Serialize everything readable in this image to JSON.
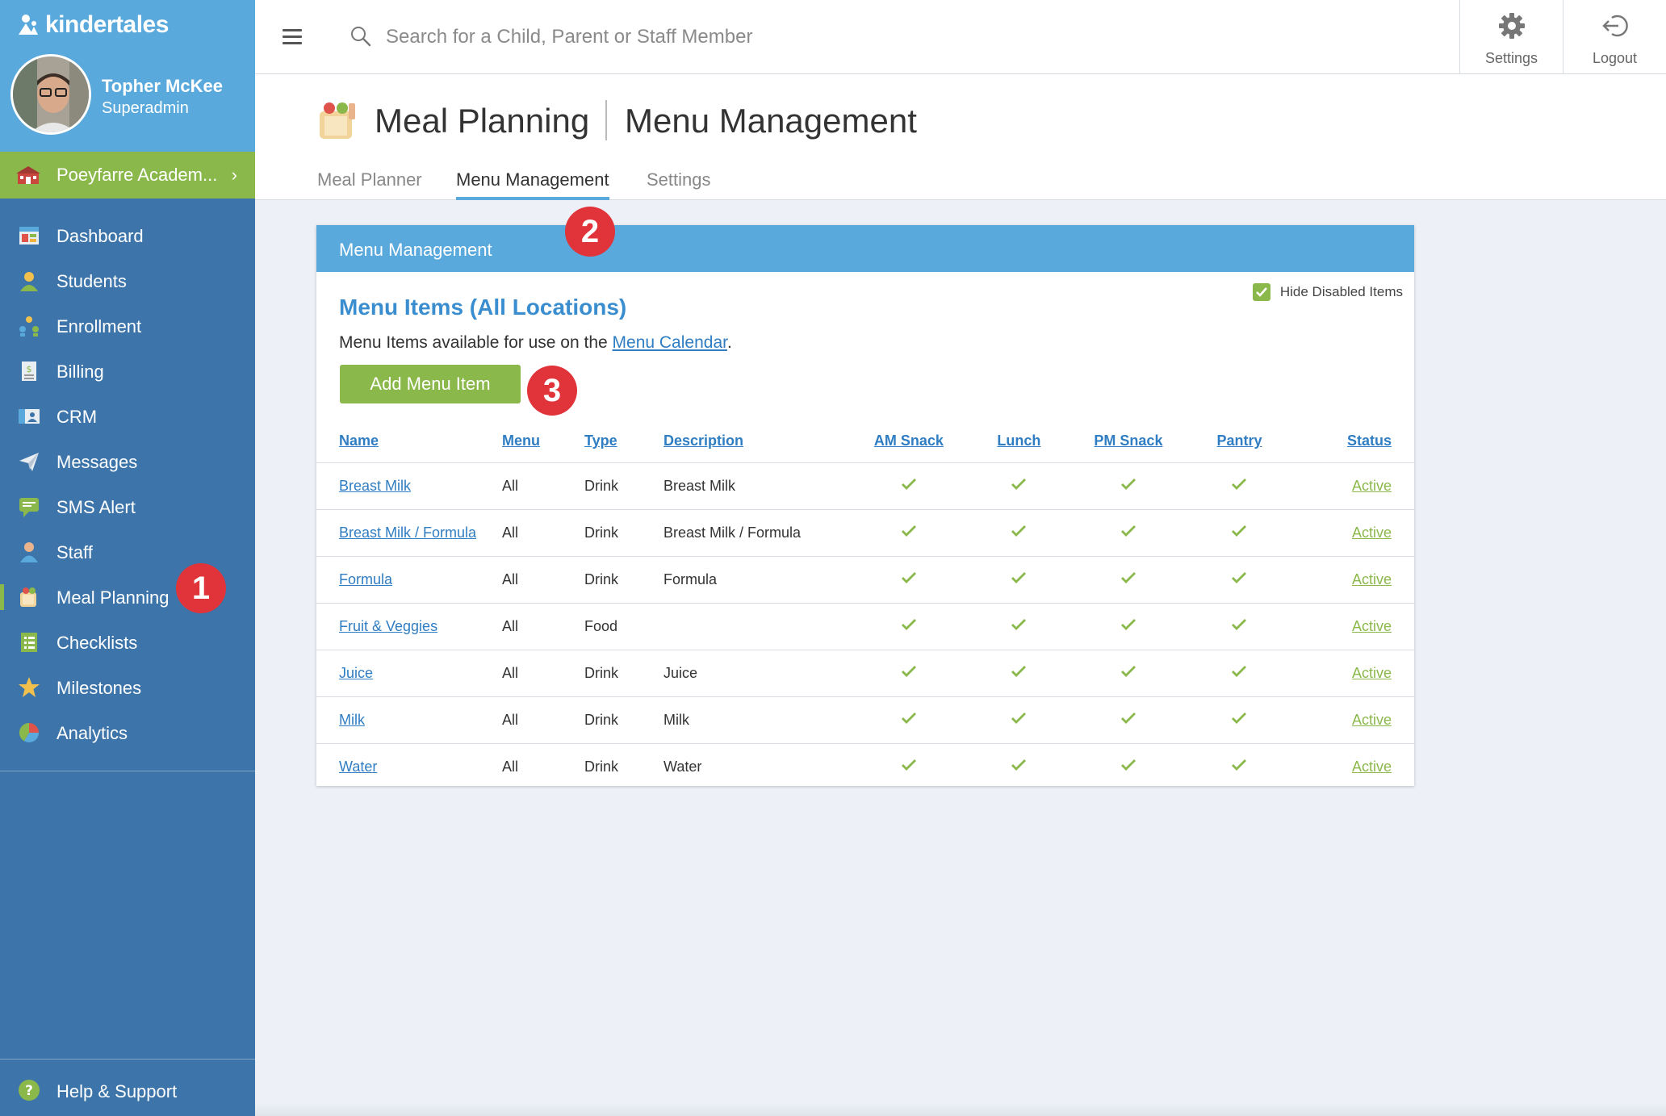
{
  "brand": {
    "logo_text": "kindertales"
  },
  "user": {
    "name": "Topher McKee",
    "role": "Superadmin"
  },
  "school": {
    "name": "Poeyfarre Academ...",
    "chevron": "›"
  },
  "nav": {
    "items": [
      {
        "label": "Dashboard",
        "icon": "dashboard-icon"
      },
      {
        "label": "Students",
        "icon": "students-icon"
      },
      {
        "label": "Enrollment",
        "icon": "enrollment-icon"
      },
      {
        "label": "Billing",
        "icon": "billing-icon"
      },
      {
        "label": "CRM",
        "icon": "crm-icon"
      },
      {
        "label": "Messages",
        "icon": "messages-icon"
      },
      {
        "label": "SMS Alert",
        "icon": "sms-alert-icon"
      },
      {
        "label": "Staff",
        "icon": "staff-icon"
      },
      {
        "label": "Meal Planning",
        "icon": "meal-planning-icon",
        "active": true
      },
      {
        "label": "Checklists",
        "icon": "checklists-icon"
      },
      {
        "label": "Milestones",
        "icon": "milestones-icon"
      },
      {
        "label": "Analytics",
        "icon": "analytics-icon"
      }
    ],
    "help_label": "Help & Support"
  },
  "topbar": {
    "search_placeholder": "Search for a Child, Parent or Staff Member",
    "settings_label": "Settings",
    "logout_label": "Logout"
  },
  "page": {
    "title": "Meal Planning",
    "subtitle": "Menu Management",
    "tabs": [
      {
        "label": "Meal Planner"
      },
      {
        "label": "Menu Management",
        "active": true
      },
      {
        "label": "Settings"
      }
    ]
  },
  "card": {
    "header": "Menu Management",
    "title": "Menu Items (All Locations)",
    "desc_prefix": "Menu Items available for use on the ",
    "desc_link": "Menu Calendar",
    "desc_suffix": ".",
    "hide_disabled_label": "Hide Disabled Items",
    "add_button": "Add Menu Item"
  },
  "table": {
    "columns": [
      "Name",
      "Menu",
      "Type",
      "Description",
      "AM Snack",
      "Lunch",
      "PM Snack",
      "Pantry",
      "Status"
    ],
    "rows": [
      {
        "name": "Breast Milk",
        "menu": "All",
        "type": "Drink",
        "description": "Breast Milk",
        "status": "Active"
      },
      {
        "name": "Breast Milk / Formula",
        "menu": "All",
        "type": "Drink",
        "description": "Breast Milk / Formula",
        "status": "Active"
      },
      {
        "name": "Formula",
        "menu": "All",
        "type": "Drink",
        "description": "Formula",
        "status": "Active"
      },
      {
        "name": "Fruit & Veggies",
        "menu": "All",
        "type": "Food",
        "description": "",
        "status": "Active"
      },
      {
        "name": "Juice",
        "menu": "All",
        "type": "Drink",
        "description": "Juice",
        "status": "Active"
      },
      {
        "name": "Milk",
        "menu": "All",
        "type": "Drink",
        "description": "Milk",
        "status": "Active"
      },
      {
        "name": "Water",
        "menu": "All",
        "type": "Drink",
        "description": "Water",
        "status": "Active"
      }
    ]
  },
  "badges": [
    "1",
    "2",
    "3"
  ],
  "colors": {
    "sidebar": "#3d75aa",
    "brand": "#59a9dd",
    "accent_green": "#8bb84a",
    "badge_red": "#e0343a"
  }
}
